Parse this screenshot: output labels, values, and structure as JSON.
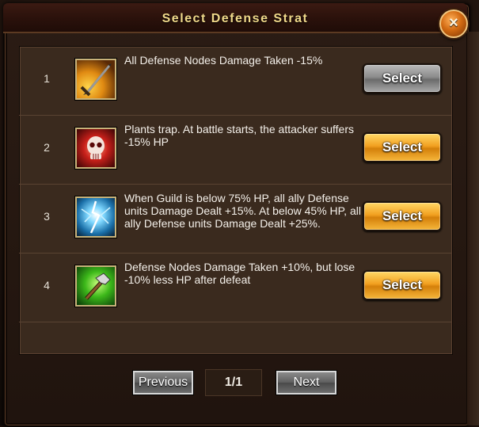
{
  "dialog": {
    "title": "Select Defense Strat",
    "close_label": "×"
  },
  "strategies": [
    {
      "index": "1",
      "icon": "sword-damage-down-icon",
      "description": "All Defense Nodes Damage Taken -15%",
      "select_label": "Select",
      "select_state": "disabled"
    },
    {
      "index": "2",
      "icon": "skull-trap-icon",
      "description": "Plants trap. At battle starts, the attacker suffers -15% HP",
      "select_label": "Select",
      "select_state": "enabled"
    },
    {
      "index": "3",
      "icon": "lightning-burst-icon",
      "description": "When Guild is below 75% HP, all ally Defense units Damage Dealt +15%. At below 45% HP, all ally Defense units Damage Dealt +25%.",
      "select_label": "Select",
      "select_state": "enabled"
    },
    {
      "index": "4",
      "icon": "hammer-repair-icon",
      "description": "Defense Nodes Damage Taken +10%, but lose -10% less HP after defeat",
      "select_label": "Select",
      "select_state": "enabled"
    }
  ],
  "pagination": {
    "previous_label": "Previous",
    "page_indicator": "1/1",
    "next_label": "Next"
  },
  "colors": {
    "title_text": "#f0d98a",
    "select_enabled": "#f2a020",
    "select_disabled": "#8c8c8c",
    "panel_bg": "#3a2a1e"
  }
}
